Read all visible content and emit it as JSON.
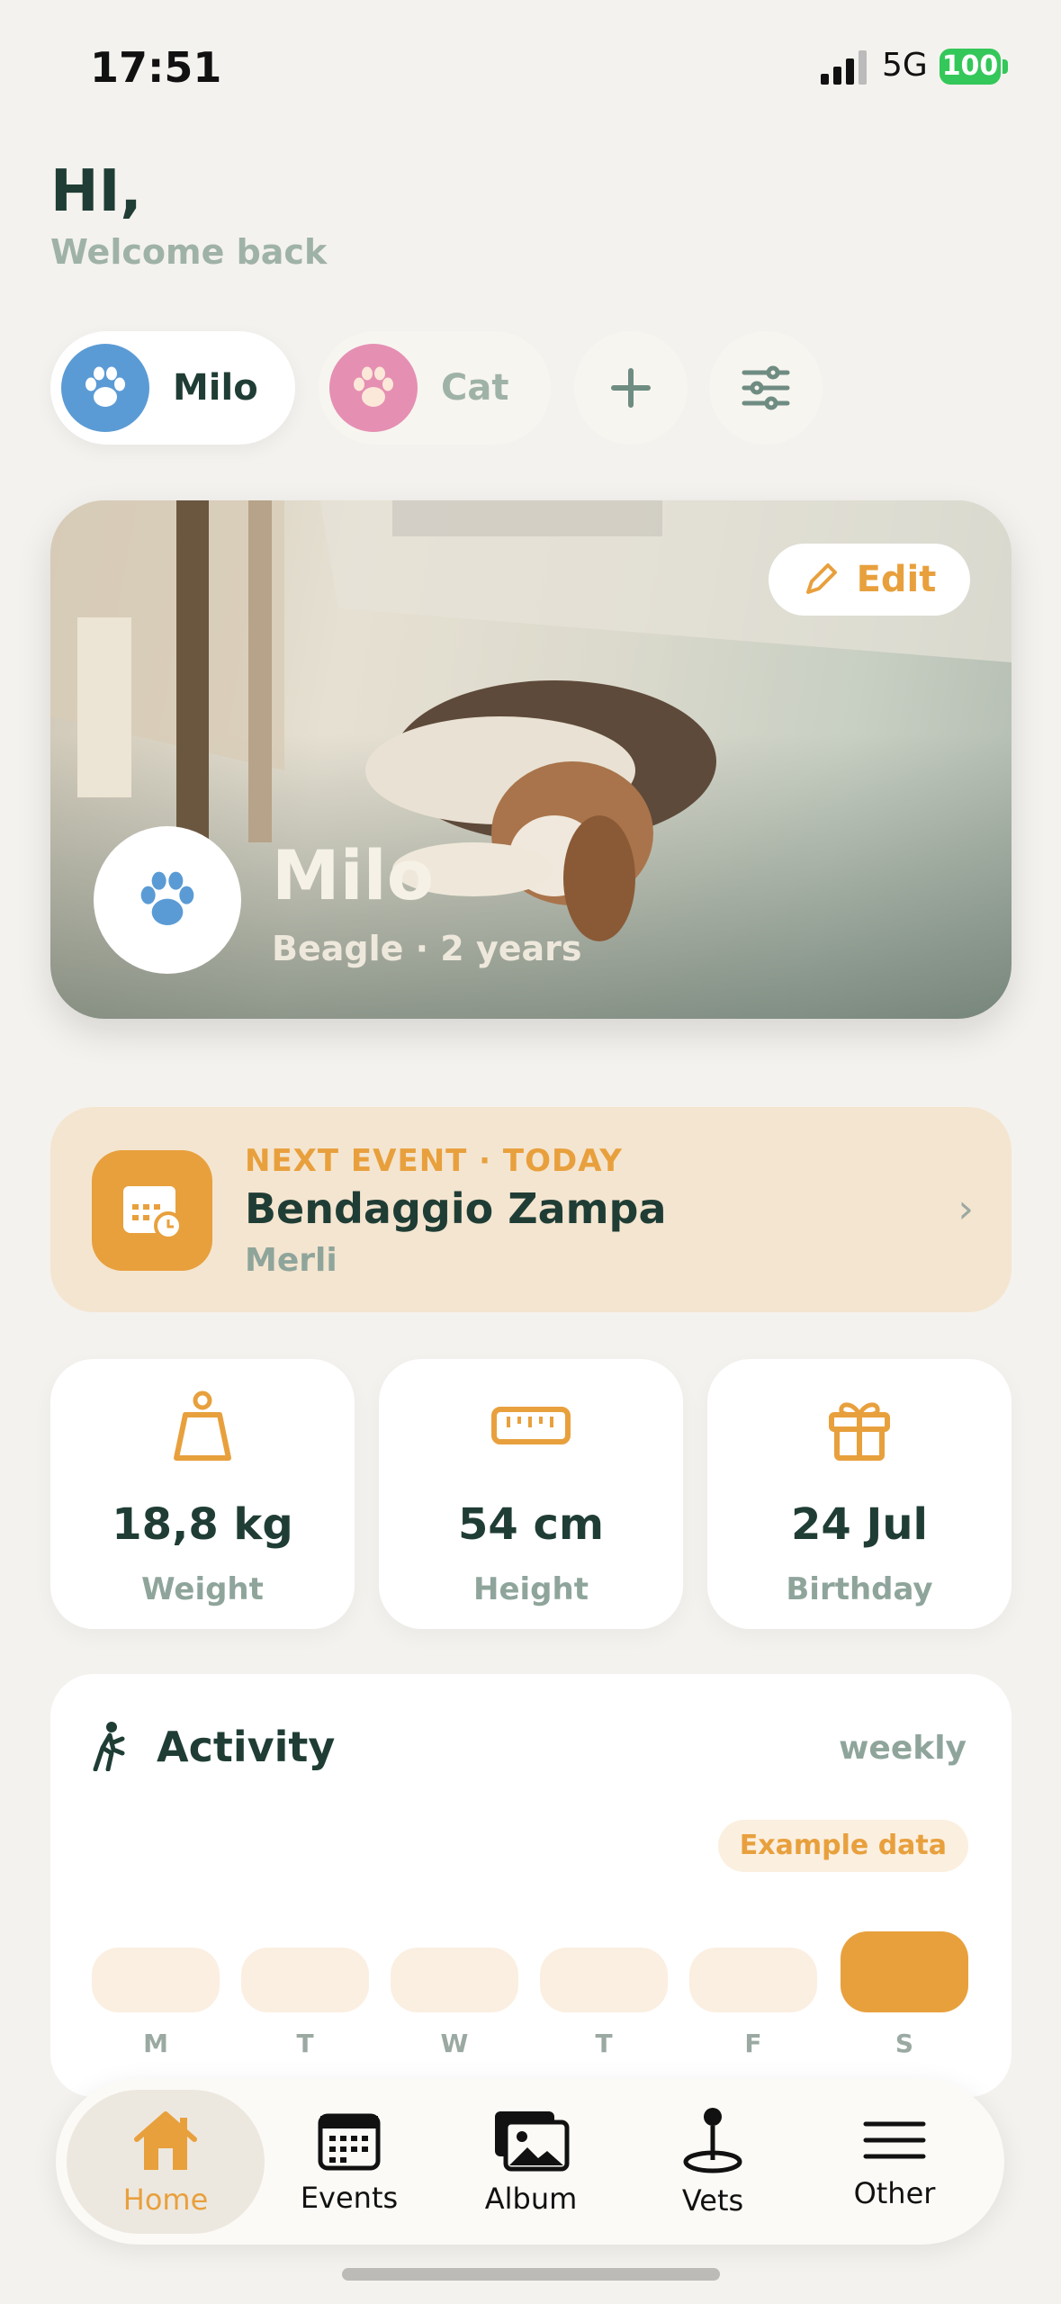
{
  "status_bar": {
    "time": "17:51",
    "network": "5G",
    "battery": "100"
  },
  "header": {
    "greeting": "HI,",
    "subtitle": "Welcome back"
  },
  "pets": [
    {
      "name": "Milo",
      "color": "#5b9bd5"
    },
    {
      "name": "Cat",
      "color": "#e58fb3"
    }
  ],
  "hero": {
    "edit_label": "Edit",
    "name": "Milo",
    "details": "Beagle · 2 years"
  },
  "next_event": {
    "kicker": "NEXT EVENT · TODAY",
    "title": "Bendaggio Zampa",
    "subtitle": "Merli"
  },
  "stats": [
    {
      "value": "18,8 kg",
      "label": "Weight",
      "icon": "weight-icon"
    },
    {
      "value": "54 cm",
      "label": "Height",
      "icon": "ruler-icon"
    },
    {
      "value": "24 Jul",
      "label": "Birthday",
      "icon": "gift-icon"
    }
  ],
  "activity": {
    "title": "Activity",
    "period": "weekly",
    "badge": "Example data",
    "days": [
      "M",
      "T",
      "W",
      "T",
      "F",
      "S"
    ],
    "active_day": "S"
  },
  "tabs": [
    {
      "label": "Home",
      "icon": "house-icon",
      "active": true
    },
    {
      "label": "Events",
      "icon": "calendar-icon",
      "active": false
    },
    {
      "label": "Album",
      "icon": "photos-icon",
      "active": false
    },
    {
      "label": "Vets",
      "icon": "map-pin-icon",
      "active": false
    },
    {
      "label": "Other",
      "icon": "menu-icon",
      "active": false
    }
  ],
  "colors": {
    "accent": "#e8a03d",
    "primary_text": "#1f3d35",
    "muted_text": "#8fa59b"
  }
}
